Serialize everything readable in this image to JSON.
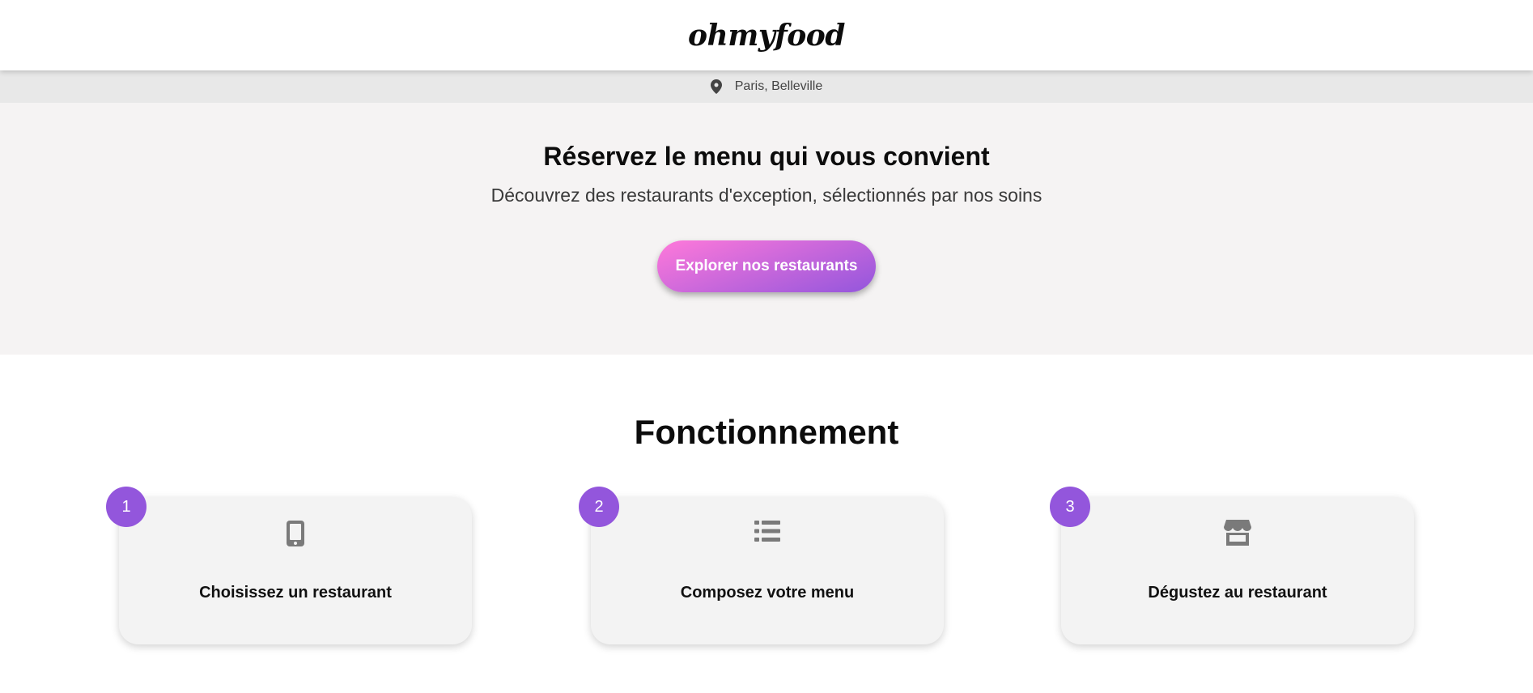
{
  "header": {
    "logo": "ohmyfood"
  },
  "location": {
    "icon": "map-pin-icon",
    "text": "Paris, Belleville"
  },
  "hero": {
    "title": "Réservez le menu qui vous convient",
    "subtitle": "Découvrez des restaurants d'exception, sélectionnés par nos soins",
    "cta_label": "Explorer nos restaurants"
  },
  "how_it_works": {
    "title": "Fonctionnement",
    "steps": [
      {
        "number": "1",
        "icon": "mobile-phone-icon",
        "label": "Choisissez un restaurant"
      },
      {
        "number": "2",
        "icon": "list-icon",
        "label": "Composez votre menu"
      },
      {
        "number": "3",
        "icon": "store-icon",
        "label": "Dégustez au restaurant"
      }
    ]
  },
  "colors": {
    "accent_purple": "#9356dc",
    "accent_pink": "#ff79da",
    "hero_bg": "#f5f3f3",
    "location_bg": "#e8e8e8",
    "card_bg": "#f3f3f3",
    "icon_gray": "#7a7a7a"
  }
}
